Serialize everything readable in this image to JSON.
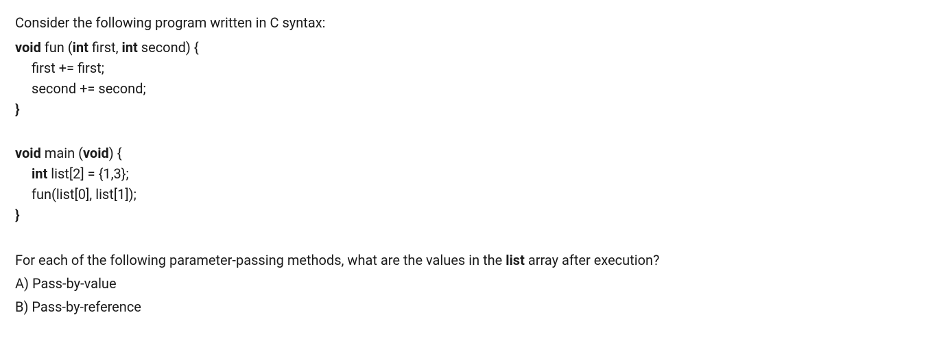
{
  "intro": "Consider the following program written in C syntax:",
  "code": {
    "fun_sig": {
      "kw_void": "void",
      "sp1": " ",
      "name": "fun (",
      "kw_int1": "int",
      "sp2": " ",
      "param1": "first, ",
      "kw_int2": "int",
      "sp3": " ",
      "param2": "second) {"
    },
    "fun_body1": "first += first;",
    "fun_body2": "second += second;",
    "fun_close": "}",
    "main_sig": {
      "kw_void1": "void",
      "sp1": " ",
      "name": "main (",
      "kw_void2": "void",
      "paren": ") {"
    },
    "main_body1": {
      "kw_int": "int",
      "sp": " ",
      "rest": "list[2] = {1,3};"
    },
    "main_body2": "fun(list[0], list[1]);",
    "main_close": "}"
  },
  "question": {
    "prefix": "For each of the following parameter-passing methods, what are the values in the ",
    "bold": "list",
    "suffix": " array after execution?"
  },
  "options": {
    "a": "A) Pass-by-value",
    "b": "B) Pass-by-reference"
  }
}
